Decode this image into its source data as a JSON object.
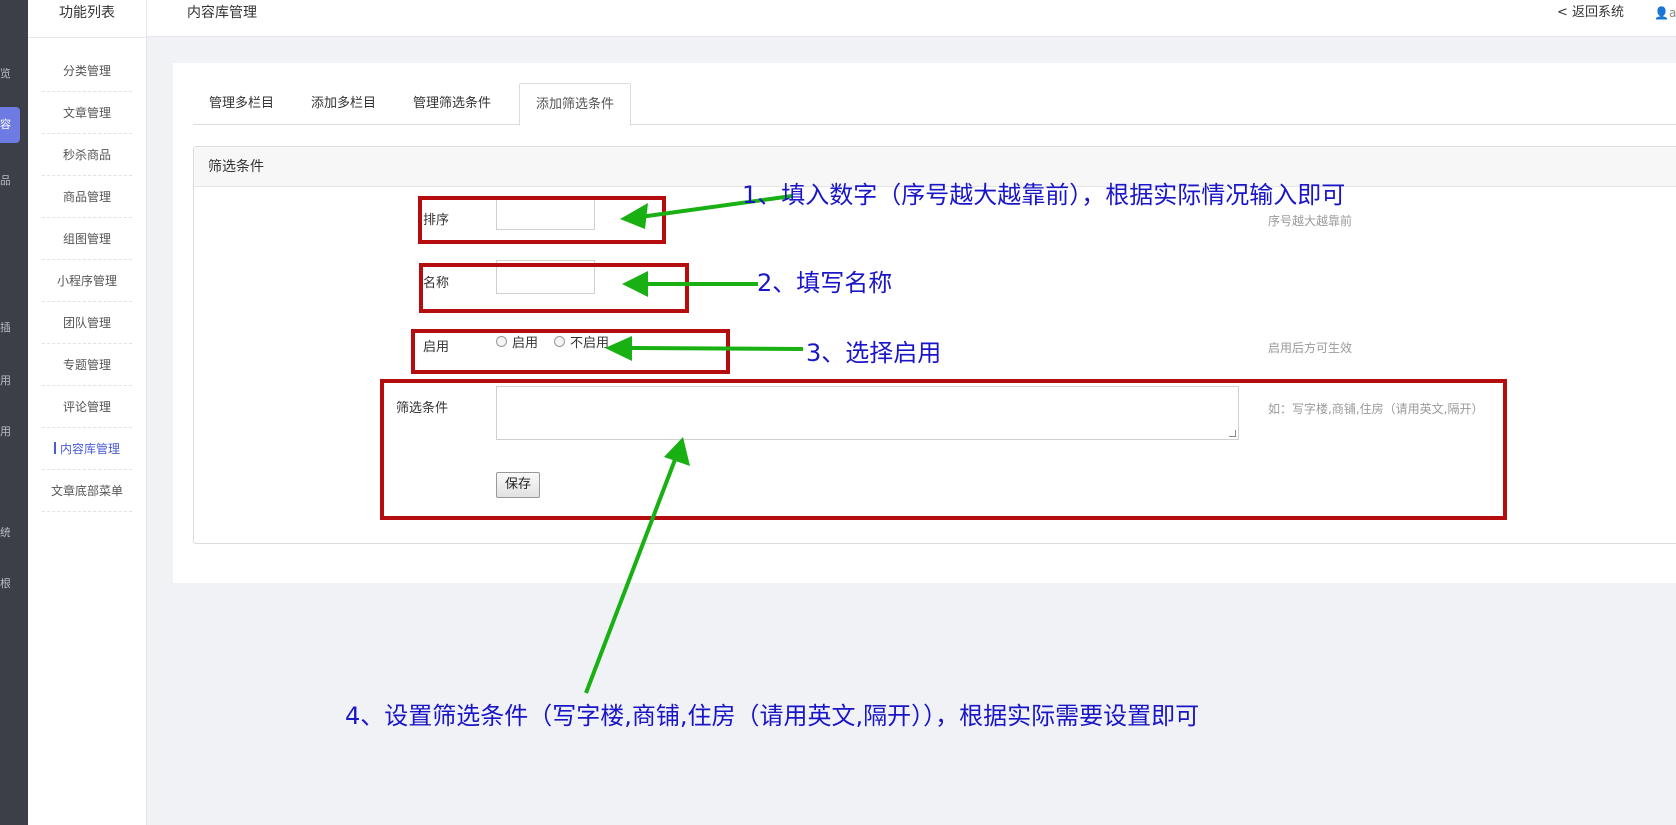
{
  "rail": {
    "glyphs": [
      "览",
      "容",
      "品",
      "插",
      "用",
      "统",
      "根"
    ],
    "active_glyph": "容"
  },
  "sidebar": {
    "title": "功能列表",
    "items": [
      {
        "label": "分类管理"
      },
      {
        "label": "文章管理"
      },
      {
        "label": "秒杀商品"
      },
      {
        "label": "商品管理"
      },
      {
        "label": "组图管理"
      },
      {
        "label": "小程序管理"
      },
      {
        "label": "团队管理"
      },
      {
        "label": "专题管理"
      },
      {
        "label": "评论管理"
      },
      {
        "label": "内容库管理"
      },
      {
        "label": "文章底部菜单"
      }
    ]
  },
  "topbar": {
    "title": "内容库管理",
    "back_label": "< 返回系统",
    "user_label": "a"
  },
  "tabs": [
    {
      "label": "管理多栏目"
    },
    {
      "label": "添加多栏目"
    },
    {
      "label": "管理筛选条件"
    },
    {
      "label": "添加筛选条件"
    }
  ],
  "form": {
    "header": "筛选条件",
    "sort": {
      "label": "排序",
      "value": "",
      "hint": "序号越大越靠前"
    },
    "name": {
      "label": "名称",
      "value": ""
    },
    "enable": {
      "label": "启用",
      "option_on": "启用",
      "option_off": "不启用",
      "hint": "启用后方可生效"
    },
    "conditions": {
      "label": "筛选条件",
      "value": "",
      "hint": "如：写字楼,商铺,住房（请用英文,隔开）"
    },
    "save_label": "保存"
  },
  "annotations": {
    "step1": "1、填入数字（序号越大越靠前），根据实际情况输入即可",
    "step2": "2、填写名称",
    "step3": "3、选择启用",
    "step4": "4、设置筛选条件（写字楼,商铺,住房（请用英文,隔开）），根据实际需要设置即可",
    "box_color": "#b50d0d",
    "arrow_color": "#19b014",
    "text_color": "#1a16c8"
  }
}
